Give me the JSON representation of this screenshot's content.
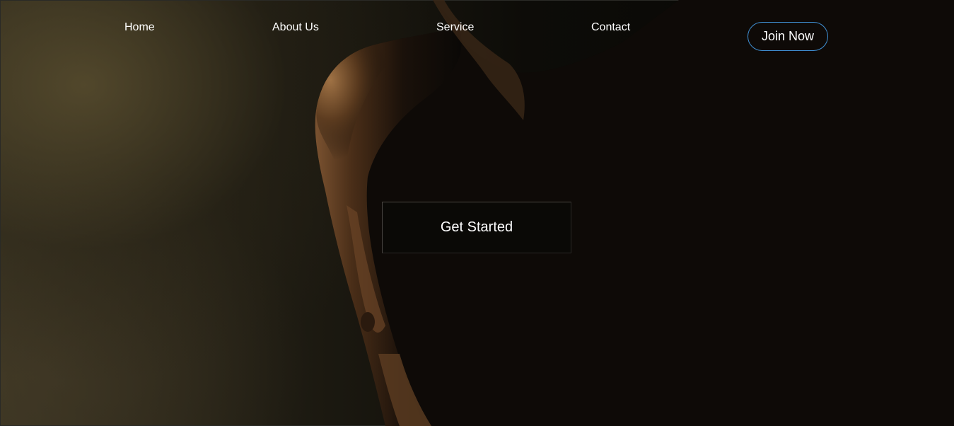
{
  "nav": {
    "items": [
      {
        "label": "Home"
      },
      {
        "label": "About Us"
      },
      {
        "label": "Service"
      },
      {
        "label": "Contact"
      }
    ],
    "join_label": "Join Now"
  },
  "hero": {
    "cta_label": "Get Started"
  },
  "colors": {
    "join_border": "#3f8fd2",
    "text": "#ffffff",
    "background": "#070705"
  }
}
